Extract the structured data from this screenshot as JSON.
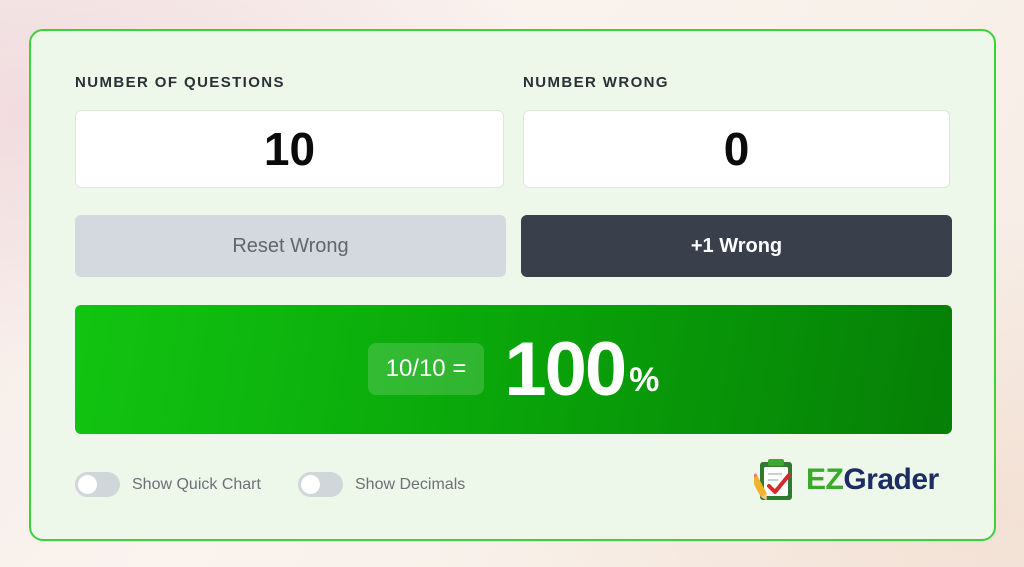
{
  "questions": {
    "label": "NUMBER OF QUESTIONS",
    "value": "10"
  },
  "wrong": {
    "label": "NUMBER WRONG",
    "value": "0"
  },
  "buttons": {
    "reset_label": "Reset Wrong",
    "add_wrong_label": "+1 Wrong"
  },
  "result": {
    "fraction": "10/10 =",
    "percent": "100",
    "percent_sign": "%",
    "score_fraction": 1.0
  },
  "toggles": [
    {
      "label": "Show Quick Chart",
      "on": false
    },
    {
      "label": "Show Decimals",
      "on": false
    }
  ],
  "logo": {
    "part1": "EZ",
    "part2": "Grader",
    "icon": "clipboard-check-icon"
  },
  "colors": {
    "card_border": "#3ed13e",
    "card_bg": "#eef8ea",
    "result_green": "#0aa80a",
    "button_dark": "#3a404b",
    "button_light": "#d3d9de",
    "brand_green": "#3aaa2a",
    "brand_navy": "#1d2d63"
  }
}
